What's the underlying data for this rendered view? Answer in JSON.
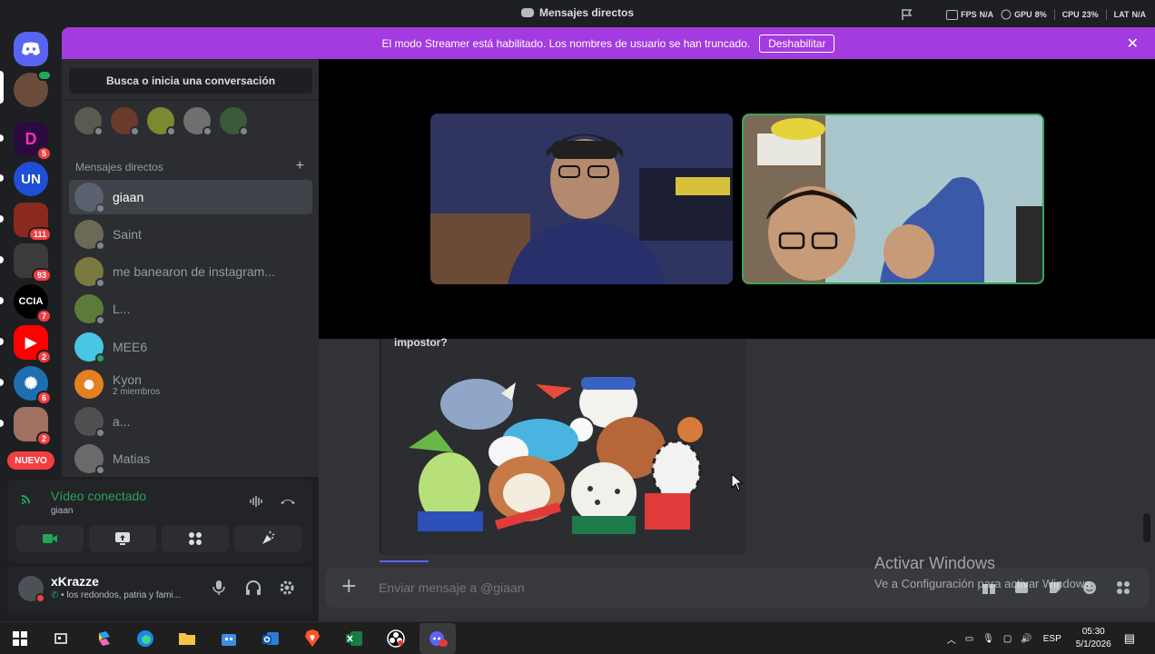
{
  "window": {
    "title": "Mensajes directos",
    "perf": {
      "fps_label": "FPS",
      "fps_value": "N/A",
      "gpu_label": "GPU",
      "gpu_value": "8%",
      "cpu_label": "CPU",
      "cpu_value": "23%",
      "lat_label": "LAT",
      "lat_value": "N/A"
    }
  },
  "banner": {
    "text": "El modo Streamer está habilitado. Los nombres de usuario se han truncado.",
    "button_label": "Deshabilitar",
    "close_icon": "close-icon"
  },
  "servers": [
    {
      "name": "discord-home",
      "label": "",
      "badge": ""
    },
    {
      "name": "user-avatar",
      "label": "",
      "badge": ""
    },
    {
      "name": "server-p",
      "label": "D",
      "badge": "5",
      "color": "#2b0a3d"
    },
    {
      "name": "server-un",
      "label": "UN",
      "badge": "",
      "color": "#1e4fd6"
    },
    {
      "name": "server-red",
      "label": "",
      "badge": "111",
      "color": "#8a2a1f"
    },
    {
      "name": "server-dark",
      "label": "",
      "badge": "93",
      "color": "#3b3b3b"
    },
    {
      "name": "server-ccia",
      "label": "CCIA",
      "badge": "7",
      "color": "#000000"
    },
    {
      "name": "server-youtube",
      "label": "▶",
      "badge": "2",
      "color": "#ff0000"
    },
    {
      "name": "server-blue",
      "label": "",
      "badge": "6",
      "color": "#1f6fb0"
    },
    {
      "name": "server-photo",
      "label": "",
      "badge": "2",
      "color": "#a07060"
    }
  ],
  "new_badge": "NUEVO",
  "dm_sidebar": {
    "search_label": "Busca o inicia una conversación",
    "header": "Mensajes directos",
    "add_icon": "plus-icon",
    "dms": [
      {
        "name": "giaan",
        "sub": "",
        "active": true,
        "online": false,
        "color": "#5a6270"
      },
      {
        "name": "Saint",
        "sub": "",
        "active": false,
        "online": false,
        "color": "#6b6b55"
      },
      {
        "name": "me banearon de instagram...",
        "sub": "",
        "active": false,
        "online": false,
        "color": "#7a7a40"
      },
      {
        "name": "L...",
        "sub": "",
        "active": false,
        "online": false,
        "color": "#5c7a3a"
      },
      {
        "name": "MEE6",
        "sub": "",
        "active": false,
        "online": true,
        "color": "#49c6e5"
      },
      {
        "name": "Kyon",
        "sub": "2 miembros",
        "active": false,
        "online": false,
        "color": "#e67e22"
      },
      {
        "name": "a...",
        "sub": "",
        "active": false,
        "online": false,
        "color": "#505050"
      },
      {
        "name": "Matias",
        "sub": "",
        "active": false,
        "online": false,
        "color": "#6a6a6a"
      }
    ]
  },
  "voice": {
    "title": "Vídeo conectado",
    "sub": "giaan"
  },
  "user": {
    "name": "xKrazze",
    "status": "los redondos, patria y fami..."
  },
  "chat": {
    "message_text": "impostor?",
    "composer_placeholder": "Enviar mensaje a @giaan"
  },
  "watermark": {
    "title": "Activar Windows",
    "sub": "Ve a Configuración para activar Windows."
  },
  "taskbar": {
    "lang": "ESP",
    "time": "05:30",
    "date": "5/1/2026"
  }
}
